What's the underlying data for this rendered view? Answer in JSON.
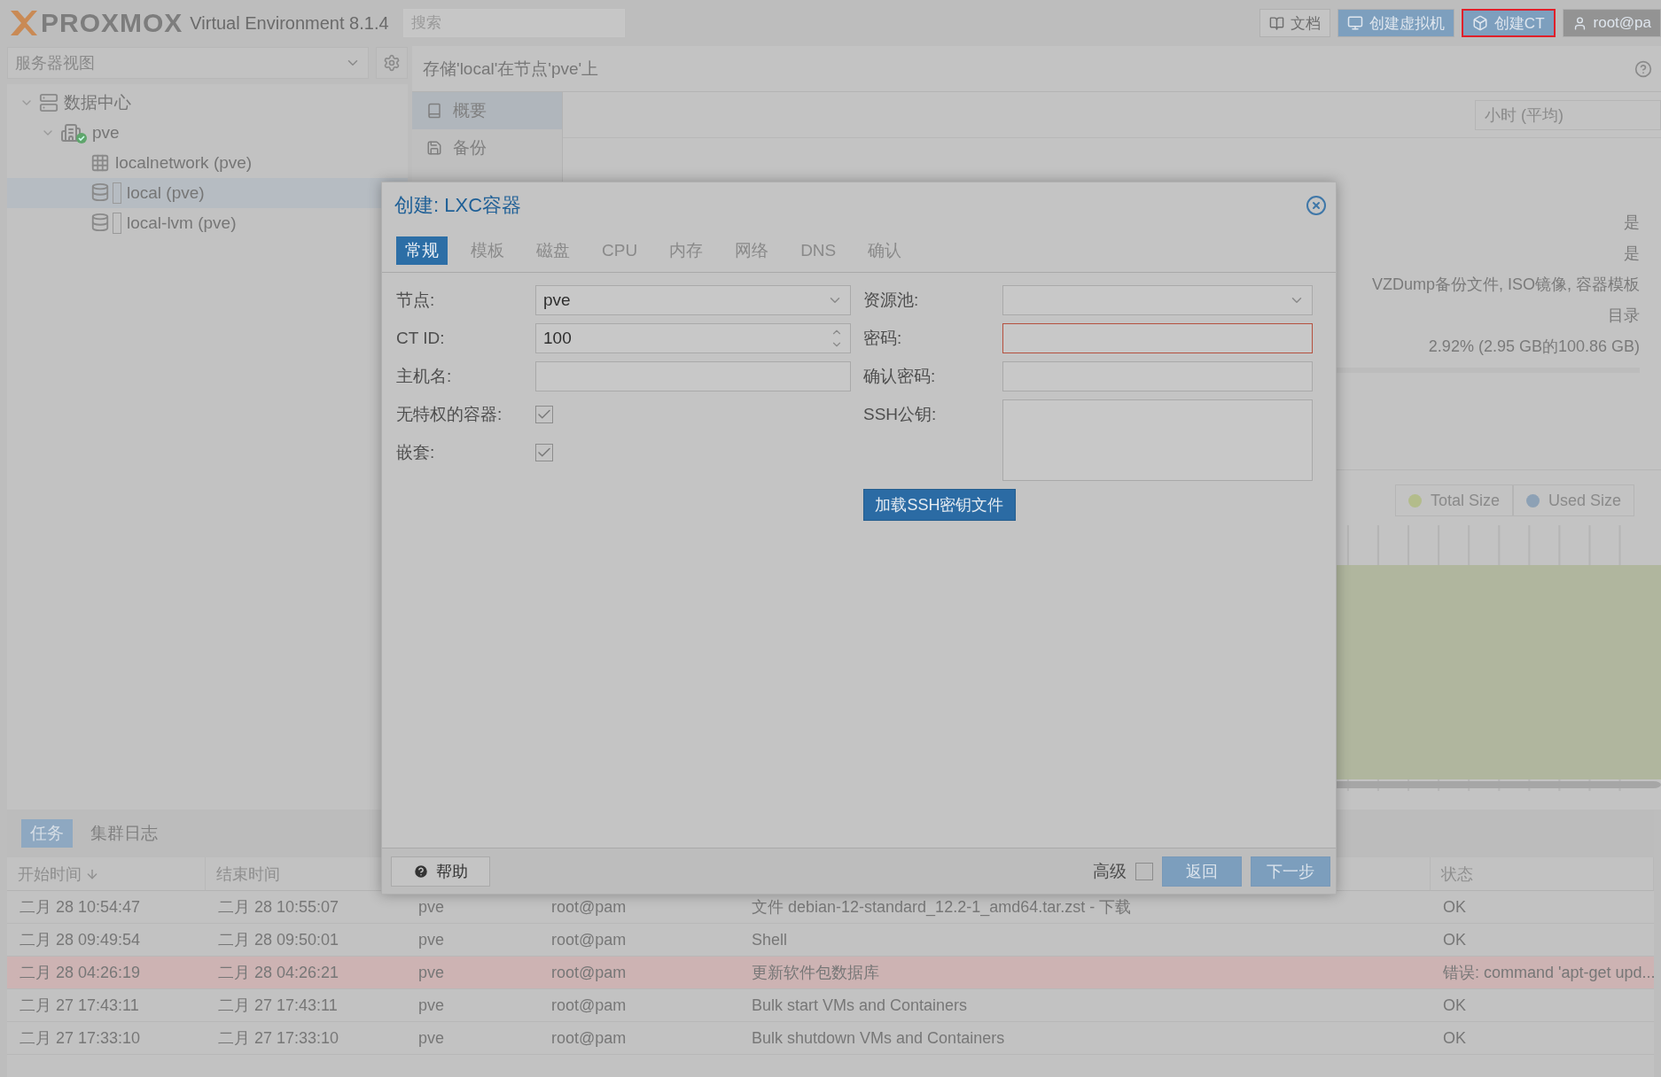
{
  "topbar": {
    "logo": "PROXMOX",
    "product": "Virtual Environment 8.1.4",
    "search": {
      "placeholder": "搜索"
    },
    "buttons": [
      {
        "label": "文档",
        "kind": "docs",
        "highlighted": false
      },
      {
        "label": "创建虚拟机",
        "kind": "vm",
        "highlighted": false
      },
      {
        "label": "创建CT",
        "kind": "ct",
        "highlighted": true
      },
      {
        "label": "root@pa",
        "kind": "user",
        "highlighted": false
      }
    ]
  },
  "sidebar": {
    "view": "服务器视图",
    "tree": [
      {
        "label": "数据中心",
        "kind": "datacenter",
        "expanded": true,
        "selected": false,
        "children": [
          {
            "label": "pve",
            "kind": "node",
            "expanded": true,
            "selected": false,
            "children": [
              {
                "label": "localnetwork (pve)",
                "kind": "network",
                "selected": false
              },
              {
                "label": "local (pve)",
                "kind": "storage",
                "selected": true
              },
              {
                "label": "local-lvm (pve)",
                "kind": "storage",
                "selected": false
              }
            ]
          }
        ]
      }
    ]
  },
  "content": {
    "title": "存储'local'在节点'pve'上",
    "nav": [
      {
        "label": "概要",
        "kind": "summary",
        "selected": true
      },
      {
        "label": "备份",
        "kind": "backup",
        "selected": false
      }
    ],
    "timeframe": "小时 (平均)",
    "status_values": [
      "是",
      "是",
      "VZDump备份文件, ISO镜像, 容器模板",
      "目录",
      "2.92% (2.95 GB的100.86 GB)"
    ],
    "usage": {
      "level": 0.0292
    },
    "legend": [
      {
        "label": "Total Size",
        "color": "#b3bc8b"
      },
      {
        "label": "Used Size",
        "color": "#8da1b5"
      }
    ]
  },
  "dialog": {
    "title": "创建: LXC容器",
    "tabs": [
      {
        "label": "常规",
        "selected": true
      },
      {
        "label": "模板",
        "selected": false
      },
      {
        "label": "磁盘",
        "selected": false
      },
      {
        "label": "CPU",
        "selected": false
      },
      {
        "label": "内存",
        "selected": false
      },
      {
        "label": "网络",
        "selected": false
      },
      {
        "label": "DNS",
        "selected": false
      },
      {
        "label": "确认",
        "selected": false
      }
    ],
    "left_fields": [
      {
        "label": "节点:",
        "kind": "select",
        "value": "pve"
      },
      {
        "label": "CT ID:",
        "kind": "spinner",
        "value": "100"
      },
      {
        "label": "主机名:",
        "kind": "text"
      },
      {
        "label": "无特权的容器:",
        "kind": "checkbox",
        "checked": true
      },
      {
        "label": "嵌套:",
        "kind": "checkbox",
        "checked": true
      }
    ],
    "right_fields": [
      {
        "label": "资源池:",
        "kind": "select"
      },
      {
        "label": "密码:",
        "kind": "password",
        "invalid": true
      },
      {
        "label": "确认密码:",
        "kind": "password",
        "invalid": false
      },
      {
        "label": "SSH公钥:",
        "kind": "textarea"
      }
    ],
    "ssh_button": "加载SSH密钥文件",
    "help": "帮助",
    "advanced": {
      "label": "高级",
      "checked": false
    },
    "back": "返回",
    "next": "下一步"
  },
  "tasks": {
    "tabs": [
      {
        "label": "任务",
        "selected": true
      },
      {
        "label": "集群日志",
        "selected": false
      }
    ],
    "columns": {
      "start": {
        "label": "开始时间",
        "sorted": true
      },
      "end": {
        "label": "结束时间"
      },
      "status": {
        "label": "状态"
      }
    },
    "rows": [
      {
        "start": "二月 28 10:54:47",
        "end": "二月 28 10:55:07",
        "node": "pve",
        "user": "root@pam",
        "description": "文件 debian-12-standard_12.2-1_amd64.tar.zst - 下载",
        "status": "OK",
        "error": false
      },
      {
        "start": "二月 28 09:49:54",
        "end": "二月 28 09:50:01",
        "node": "pve",
        "user": "root@pam",
        "description": "Shell",
        "status": "OK",
        "error": false
      },
      {
        "start": "二月 28 04:26:19",
        "end": "二月 28 04:26:21",
        "node": "pve",
        "user": "root@pam",
        "description": "更新软件包数据库",
        "status": "错误: command 'apt-get upd...",
        "error": true
      },
      {
        "start": "二月 27 17:43:11",
        "end": "二月 27 17:43:11",
        "node": "pve",
        "user": "root@pam",
        "description": "Bulk start VMs and Containers",
        "status": "OK",
        "error": false
      },
      {
        "start": "二月 27 17:33:10",
        "end": "二月 27 17:33:10",
        "node": "pve",
        "user": "root@pam",
        "description": "Bulk shutdown VMs and Containers",
        "status": "OK",
        "error": false
      }
    ]
  }
}
